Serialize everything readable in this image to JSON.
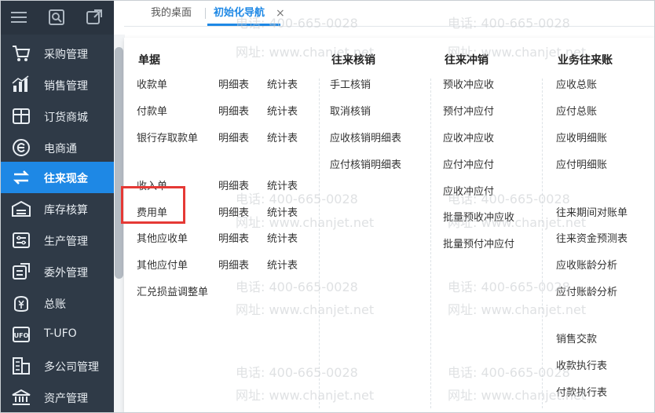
{
  "sidebar": {
    "items": [
      {
        "label": "采购管理",
        "icon": "cart-icon"
      },
      {
        "label": "销售管理",
        "icon": "bar-chart-icon"
      },
      {
        "label": "订货商城",
        "icon": "store-icon"
      },
      {
        "label": "电商通",
        "icon": "e-commerce-icon"
      },
      {
        "label": "往来现金",
        "icon": "exchange-icon"
      },
      {
        "label": "库存核算",
        "icon": "warehouse-icon"
      },
      {
        "label": "生产管理",
        "icon": "production-icon"
      },
      {
        "label": "委外管理",
        "icon": "outsource-icon"
      },
      {
        "label": "总账",
        "icon": "ledger-icon"
      },
      {
        "label": "T-UFO",
        "icon": "report-icon"
      },
      {
        "label": "多公司管理",
        "icon": "multi-company-icon"
      },
      {
        "label": "资产管理",
        "icon": "bank-icon"
      }
    ],
    "active_index": 4
  },
  "toolbar": {
    "icons": [
      "menu-icon",
      "search-icon",
      "open-window-icon"
    ]
  },
  "tabs": {
    "desk": "我的桌面",
    "nav": "初始化导航",
    "close": "×"
  },
  "panel": {
    "col1": {
      "title": "单据",
      "rows": [
        [
          "收款单",
          "明细表",
          "统计表"
        ],
        [
          "付款单",
          "明细表",
          "统计表"
        ],
        [
          "银行存取款单",
          "明细表",
          "统计表"
        ],
        [
          "收入单",
          "明细表",
          "统计表"
        ],
        [
          "费用单",
          "明细表",
          "统计表"
        ],
        [
          "其他应收单",
          "明细表",
          "统计表"
        ],
        [
          "其他应付单",
          "明细表",
          "统计表"
        ],
        [
          "汇兑损益调整单"
        ]
      ]
    },
    "col2": {
      "title": "往来核销",
      "items": [
        "手工核销",
        "取消核销",
        "应收核销明细表",
        "应付核销明细表"
      ]
    },
    "col3": {
      "title": "往来冲销",
      "items": [
        "预收冲应收",
        "预付冲应付",
        "应收冲应收",
        "应付冲应付",
        "应收冲应付",
        "批量预收冲应收",
        "批量预付冲应付"
      ]
    },
    "col4": {
      "title": "业务往来账",
      "items": [
        "应收总账",
        "应付总账",
        "应收明细账",
        "应付明细账",
        "往来期间对账单",
        "往来资金预测表",
        "应收账龄分析",
        "应付账龄分析",
        "销售交款",
        "收款执行表",
        "付款执行表"
      ]
    }
  },
  "watermark": {
    "phone": "电话: 400-665-0028",
    "site": "网址: www.chanjet.net"
  },
  "colors": {
    "sidebar_bg": "#2f3a47",
    "accent": "#1e88e5",
    "highlight": "#e53935"
  }
}
